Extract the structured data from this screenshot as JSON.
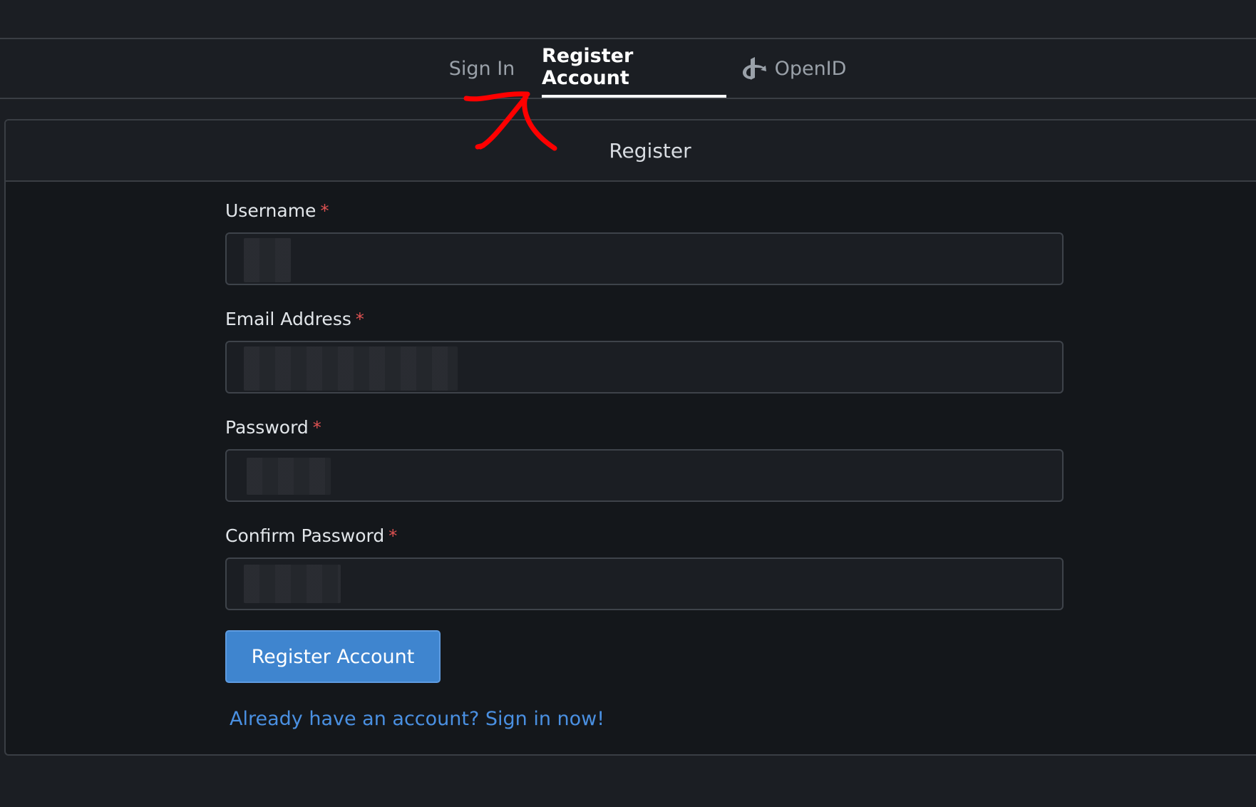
{
  "tabs": [
    {
      "label": "Sign In",
      "active": false
    },
    {
      "label": "Register Account",
      "active": true
    },
    {
      "label": "OpenID",
      "active": false,
      "icon": "openid-icon"
    }
  ],
  "panel": {
    "title": "Register"
  },
  "form": {
    "username": {
      "label": "Username",
      "required_mark": "*"
    },
    "email": {
      "label": "Email Address",
      "required_mark": "*"
    },
    "password": {
      "label": "Password",
      "required_mark": "*"
    },
    "confirm_password": {
      "label": "Confirm Password",
      "required_mark": "*"
    }
  },
  "submit_label": "Register Account",
  "signin_link": "Already have an account? Sign in now!",
  "colors": {
    "background": "#1b1e23",
    "panel": "#14171b",
    "accent": "#3f85cf",
    "link": "#4a90e2",
    "required": "#e05252",
    "annotation": "#ff0000"
  }
}
